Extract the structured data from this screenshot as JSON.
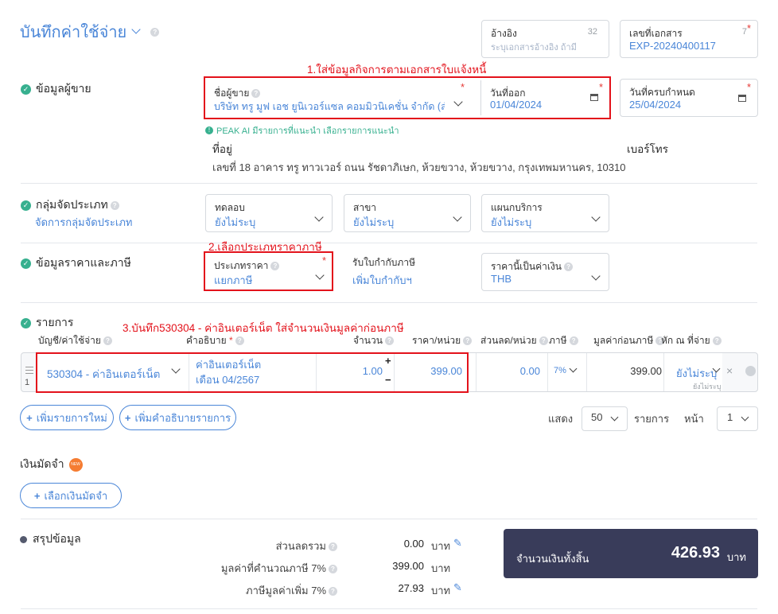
{
  "header": {
    "title": "บันทึกค่าใช้จ่าย",
    "reference": {
      "label": "อ้างอิง",
      "placeholder": "ระบุเอกสารอ้างอิง ถ้ามี",
      "counter": "32"
    },
    "doc_number": {
      "label": "เลขที่เอกสาร",
      "value": "EXP-20240400117",
      "counter": "7"
    }
  },
  "annotations": {
    "a1": "1.ใส่ข้อมูลกิจการตามเอกสารใบแจ้งหนี้",
    "a2": "2.เลือกประเภทราคาภาษี",
    "a3": "3.บันทึก530304 - ค่าอินเตอร์เน็ต  ใส่จำนวนเงินมูลค่าก่อนภาษี"
  },
  "vendor": {
    "section_title": "ข้อมูลผู้ขาย",
    "name_label": "ชื่อผู้ขาย",
    "name_value": "บริษัท ทรู มูฟ เอช ยูนิเวอร์แซล คอมมิวนิเคชั่น จำกัด (สำ...",
    "issue_date_label": "วันที่ออก",
    "issue_date": "01/04/2024",
    "due_date_label": "วันที่ครบกำหนด",
    "due_date": "25/04/2024",
    "ai_hint": "PEAK AI มีรายการที่แนะนำ เลือกรายการแนะนำ",
    "address_label": "ที่อยู่",
    "address": "เลขที่ 18 อาคาร ทรู ทาวเวอร์ ถนน รัชดาภิเษก, ห้วยขวาง, ห้วยขวาง, กรุงเทพมหานคร, 10310",
    "phone_label": "เบอร์โทร"
  },
  "category": {
    "section_title": "กลุ่มจัดประเภท",
    "manage_link": "จัดการกลุ่มจัดประเภท",
    "fields": [
      {
        "label": "ทดลอบ",
        "value": "ยังไม่ระบุ"
      },
      {
        "label": "สาขา",
        "value": "ยังไม่ระบุ"
      },
      {
        "label": "แผนกบริการ",
        "value": "ยังไม่ระบุ"
      }
    ]
  },
  "pricing": {
    "section_title": "ข้อมูลราคาและภาษี",
    "price_type_label": "ประเภทราคา",
    "price_type_value": "แยกภาษี",
    "withholding_label": "รับใบกำกับภาษี",
    "withholding_link": "เพิ่มใบกำกับฯ",
    "currency_label": "ราคานี้เป็นค่าเงิน",
    "currency_value": "THB"
  },
  "items": {
    "section_title": "รายการ",
    "columns": [
      "บัญชี/ค่าใช้จ่าย",
      "คำอธิบาย",
      "จำนวน",
      "ราคา/หน่วย",
      "ส่วนลด/หน่วย",
      "ภาษี",
      "มูลค่าก่อนภาษี",
      "หัก ณ ที่จ่าย"
    ],
    "rows": [
      {
        "index": "1",
        "account": "530304 - ค่าอินเตอร์เน็ต",
        "description": "ค่าอินเตอร์เน็ต เดือน 04/2567",
        "qty": "1.00",
        "price": "399.00",
        "discount": "0.00",
        "vat": "7%",
        "amount": "399.00",
        "wht": "ยังไม่ระบุ",
        "wht_sub": "ยังไม่ระบุ"
      }
    ],
    "add_item": "เพิ่มรายการใหม่",
    "add_desc": "เพิ่มคำอธิบายรายการ",
    "show_label": "แสดง",
    "page_size": "50",
    "items_label": "รายการ",
    "page_label": "หน้า",
    "page": "1"
  },
  "deposit": {
    "title": "เงินมัดจำ",
    "badge": "NEW",
    "select_btn": "เลือกเงินมัดจำ"
  },
  "summary": {
    "title": "สรุปข้อมูล",
    "rows": [
      {
        "label": "ส่วนลดรวม",
        "value": "0.00",
        "unit": "บาท"
      },
      {
        "label": "มูลค่าที่คำนวณภาษี 7%",
        "value": "399.00",
        "unit": "บาท"
      },
      {
        "label": "ภาษีมูลค่าเพิ่ม 7%",
        "value": "27.93",
        "unit": "บาท"
      }
    ],
    "total_label": "จำนวนเงินทั้งสิ้น",
    "total_value": "426.93",
    "total_unit": "บาท"
  },
  "colors": {
    "accent": "#4a86d8",
    "check": "#37b08f",
    "annotation": "#e3121b",
    "total_bg": "#393c5a"
  }
}
